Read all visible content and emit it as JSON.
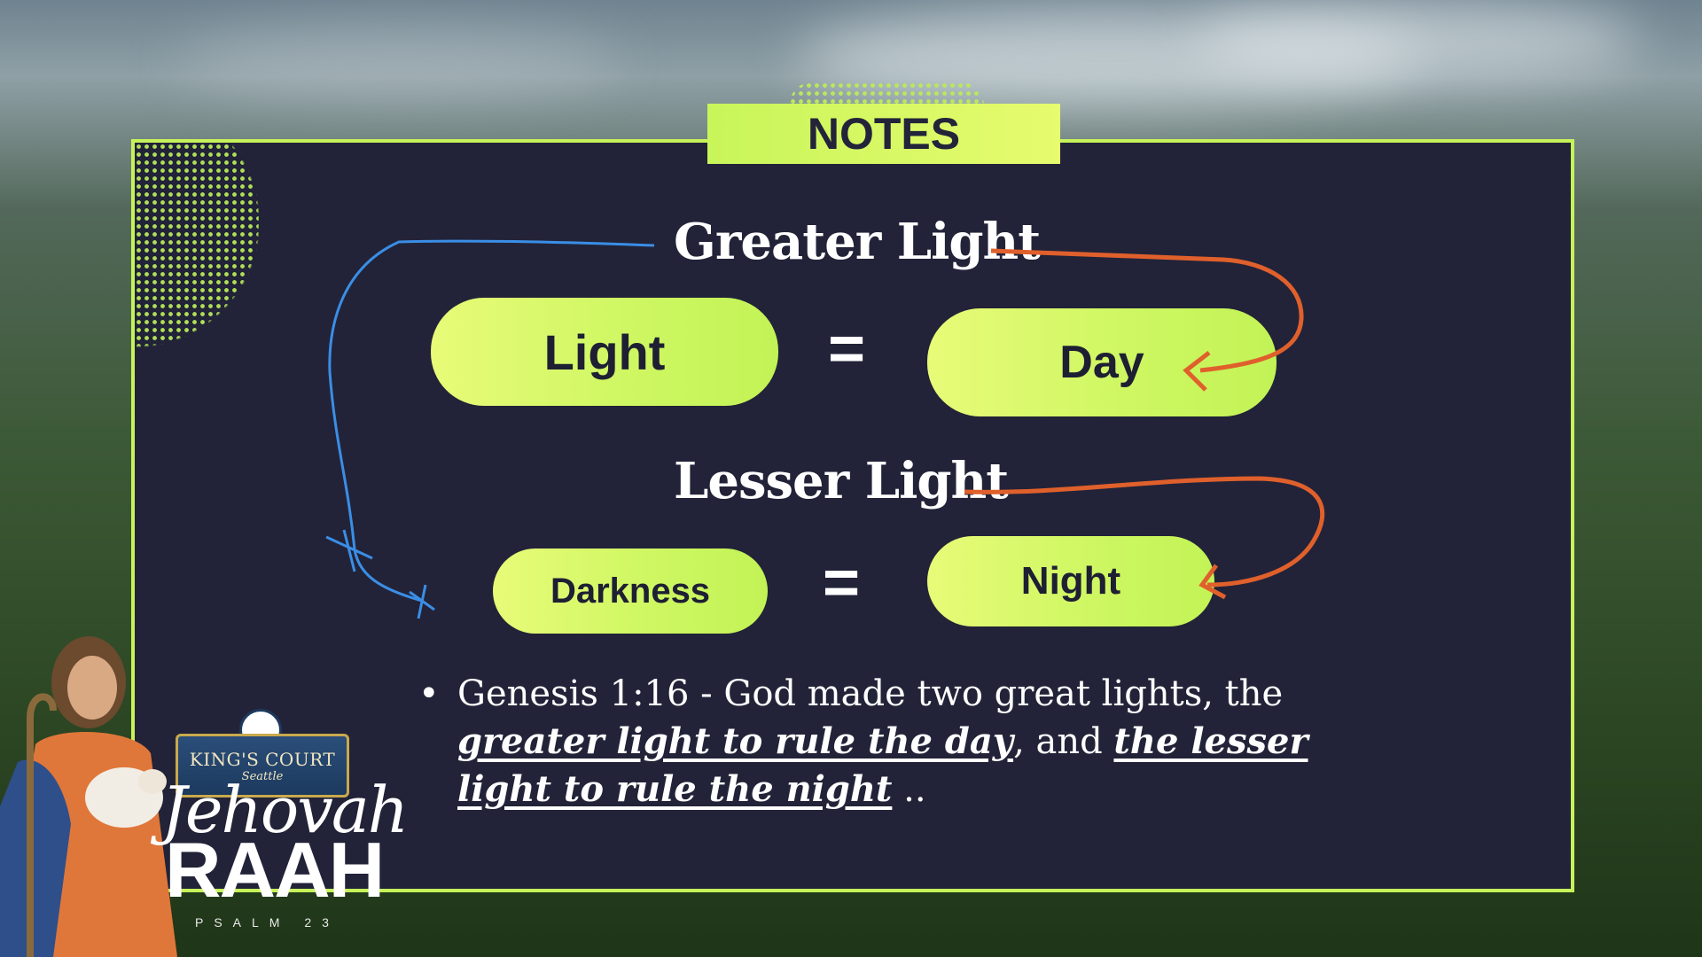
{
  "slide": {
    "notes_label": "NOTES",
    "greater_heading": "Greater Light",
    "lesser_heading": "Lesser Light",
    "equals_symbol": "=",
    "pills": {
      "light": "Light",
      "day": "Day",
      "darkness": "Darkness",
      "night": "Night"
    },
    "bullet": {
      "marker": "•",
      "prefix": "Genesis 1:16 - God made two great lights, the",
      "emph_1": "greater light to rule the day",
      "middle": ", and ",
      "emph_2": "the lesser light to rule the night",
      "suffix": " .."
    }
  },
  "branding": {
    "badge_title": "KING'S COURT",
    "badge_sub": "Seattle",
    "script_word": "Jehovah",
    "bold_word": "RAAH",
    "reference": "PSALM 23"
  },
  "colors": {
    "card_bg": "#222338",
    "accent_green": "#c6f35a",
    "arrow_orange": "#e0602c",
    "arrow_blue": "#3a8ee6"
  }
}
